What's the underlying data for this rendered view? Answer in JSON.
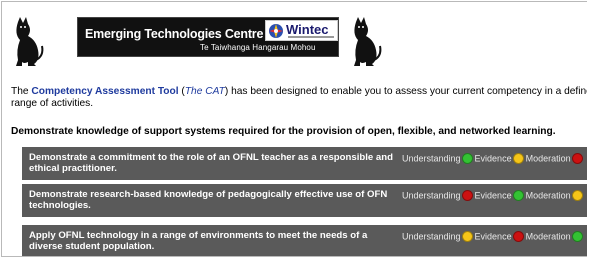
{
  "header": {
    "banner_title": "Emerging Technologies Centre",
    "banner_subtitle": "Te Taiwhanga Hangarau Mohou",
    "logo_text": "Wintec"
  },
  "intro": {
    "prefix": "The ",
    "tool_link": "Competency Assessment Tool",
    "open_paren": " (",
    "abbr_link": "The CAT",
    "suffix": ") has been designed to enable you to assess your current competency in a defined range of activities."
  },
  "heading": "Demonstrate knowledge of support systems required for the provision of open, flexible, and networked learning.",
  "indicator_labels": {
    "understanding": "Understanding",
    "evidence": "Evidence",
    "moderation": "Moderation"
  },
  "status_colors": {
    "green": "#33c233",
    "yellow": "#f5c518",
    "red": "#cc1111"
  },
  "competencies": [
    {
      "text": "Demonstrate a commitment to the role of an OFNL teacher as a responsible and ethical practitioner.",
      "understanding": "green",
      "evidence": "yellow",
      "moderation": "red"
    },
    {
      "text": "Demonstrate research-based knowledge of pedagogically effective use of OFN technologies.",
      "understanding": "red",
      "evidence": "green",
      "moderation": "yellow"
    },
    {
      "text": "Apply OFNL technology in a range of environments to meet the needs of a diverse student population.",
      "understanding": "yellow",
      "evidence": "red",
      "moderation": "green"
    }
  ]
}
